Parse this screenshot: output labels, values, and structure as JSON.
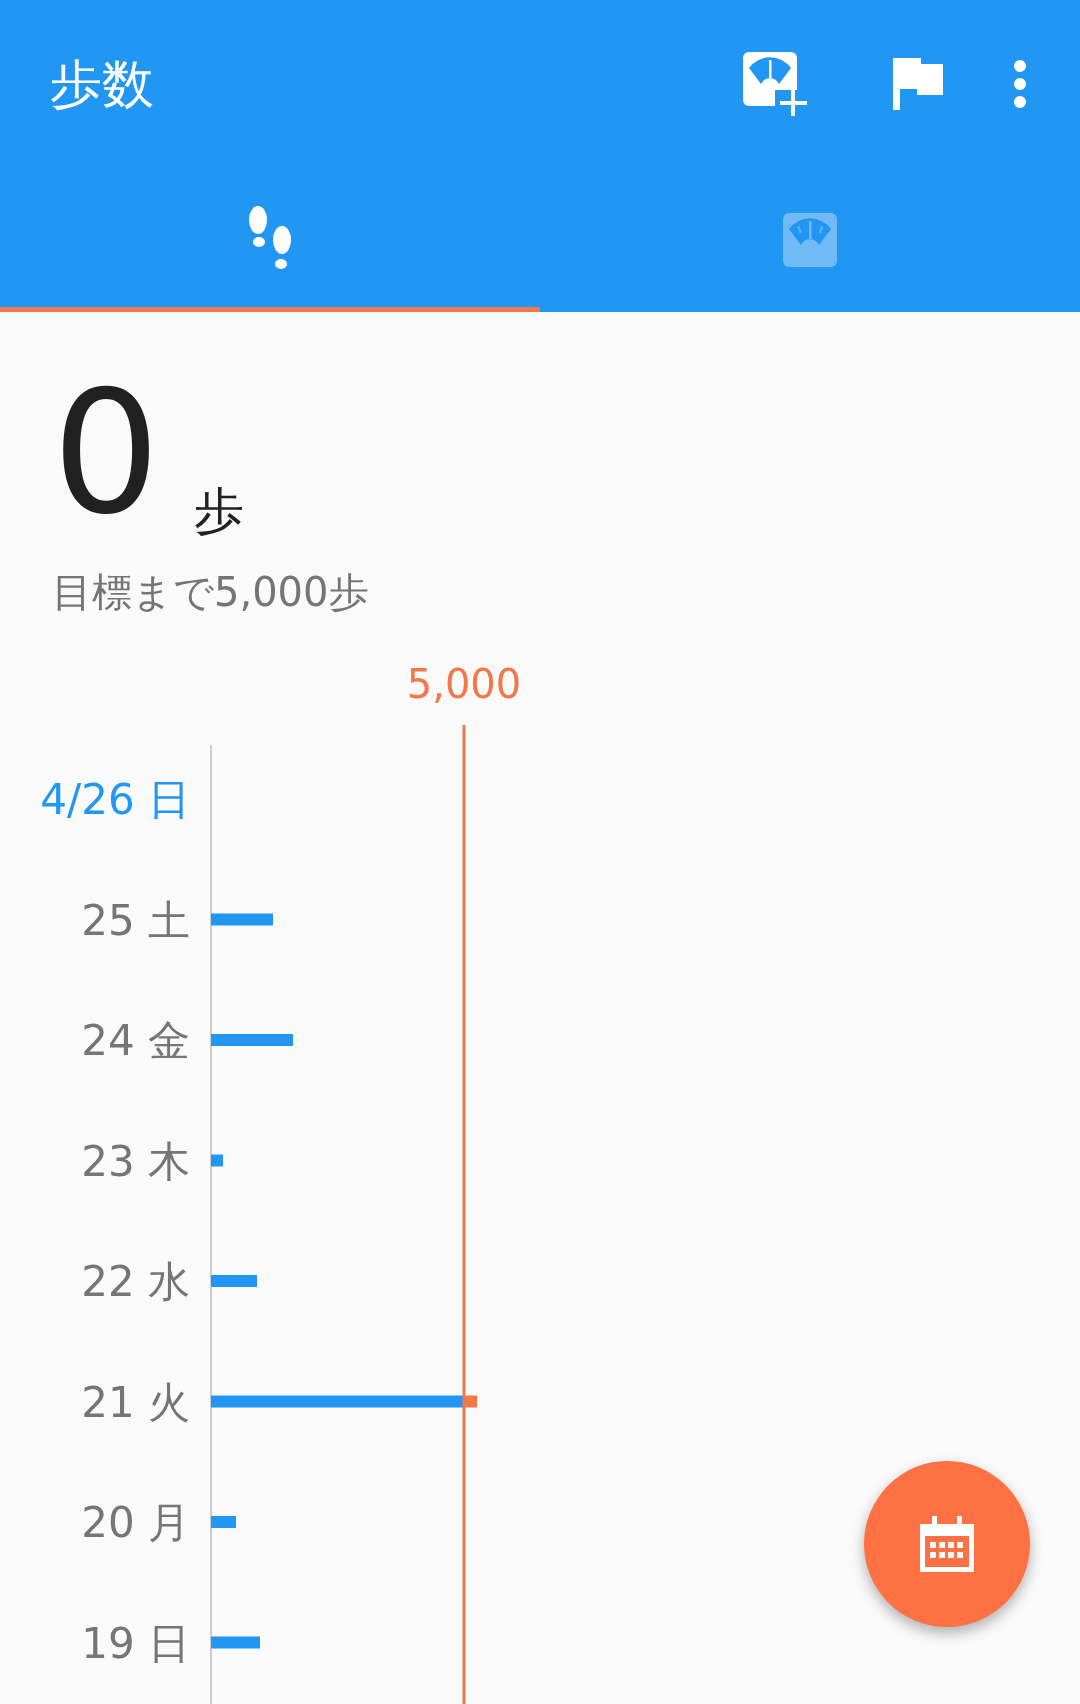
{
  "app_bar": {
    "title": "歩数"
  },
  "tabs": [
    {
      "kind": "steps",
      "selected": true
    },
    {
      "kind": "weight",
      "selected": false
    }
  ],
  "summary": {
    "count": "0",
    "unit": "歩",
    "remaining": "目標まで5,000歩"
  },
  "chart": {
    "goal_label": "5,000",
    "days": [
      {
        "label": "4/26 日",
        "selected": true
      },
      {
        "label": "25 土",
        "selected": false
      },
      {
        "label": "24 金",
        "selected": false
      },
      {
        "label": "23 木",
        "selected": false
      },
      {
        "label": "22 水",
        "selected": false
      },
      {
        "label": "21 火",
        "selected": false
      },
      {
        "label": "20 月",
        "selected": false
      },
      {
        "label": "19 日",
        "selected": false
      }
    ]
  }
}
